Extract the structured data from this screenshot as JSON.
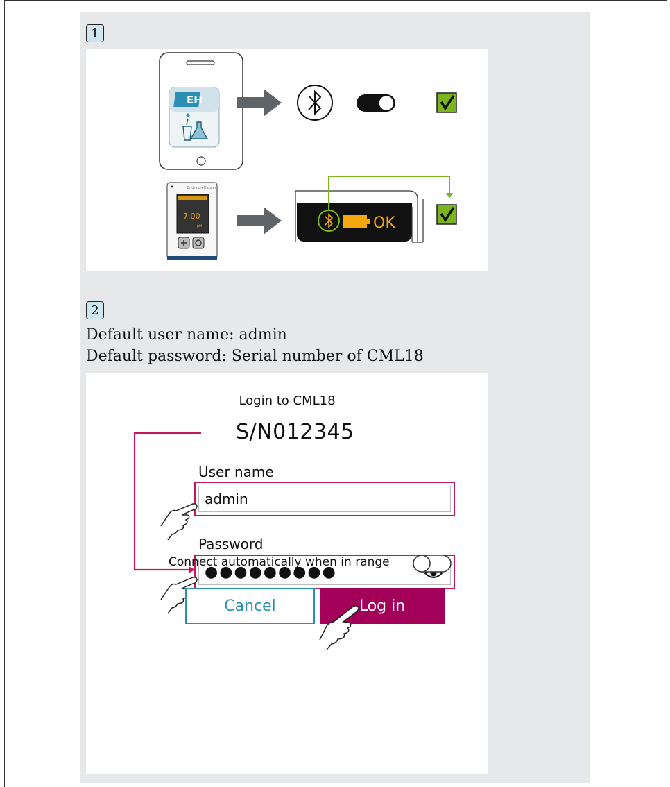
{
  "step1": {
    "badge": "1",
    "device_screen": {
      "reading": "7.00",
      "unit": "pH"
    },
    "status_ok": "OK"
  },
  "step2": {
    "badge": "2",
    "line1": "Default user name: admin",
    "line2": "Default password: Serial number of CML18"
  },
  "login": {
    "title": "Login to CML18",
    "serial": "S/N012345",
    "username_label": "User name",
    "username_value": "admin",
    "password_label": "Password",
    "password_value": "●●●●●●●●●",
    "connect_label": "Connect automatically when in range",
    "cancel_label": "Cancel",
    "login_label": "Log in"
  },
  "colors": {
    "panel_gray": "#e6e8ea",
    "magenta": "#c2185b",
    "login_button": "#a3005a",
    "cancel_blue": "#2b8fb5",
    "check_green": "#7ab51d",
    "arrow_gray": "#5f6468",
    "status_orange": "#f4a80d"
  }
}
